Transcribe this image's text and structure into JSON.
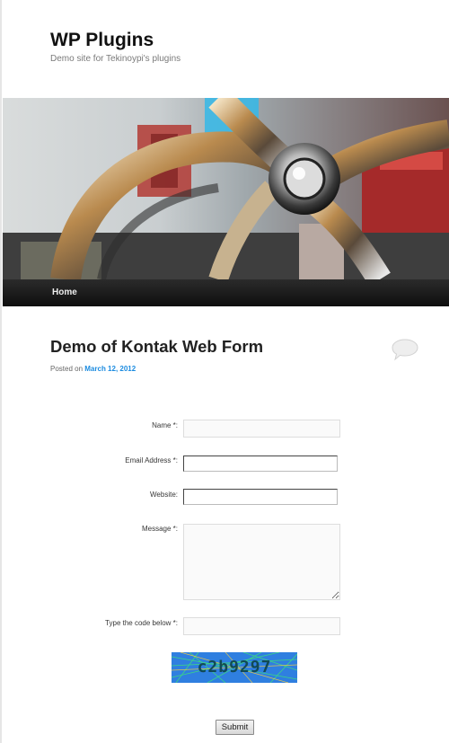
{
  "site": {
    "title": "WP Plugins",
    "description": "Demo site for Tekinoypi's plugins"
  },
  "banner": {
    "image": "chrome-wheel-photo"
  },
  "nav": {
    "items": [
      {
        "label": "Home"
      }
    ]
  },
  "post": {
    "title": "Demo of Kontak Web Form",
    "posted_prefix": "Posted on",
    "date": "March 12, 2012",
    "comment_icon": "speech-bubble-icon"
  },
  "form": {
    "name_label": "Name *:",
    "name_value": "",
    "email_label": "Email Address *:",
    "email_value": "",
    "website_label": "Website:",
    "website_value": "",
    "message_label": "Message *:",
    "message_value": "",
    "code_label": "Type the code below *:",
    "code_value": "",
    "captcha_code": "c2b9297",
    "submit_label": "Submit"
  },
  "colors": {
    "link": "#1b8be0",
    "nav_bg": "#1a1a1a",
    "captcha_bg": "#2f7fe0"
  }
}
